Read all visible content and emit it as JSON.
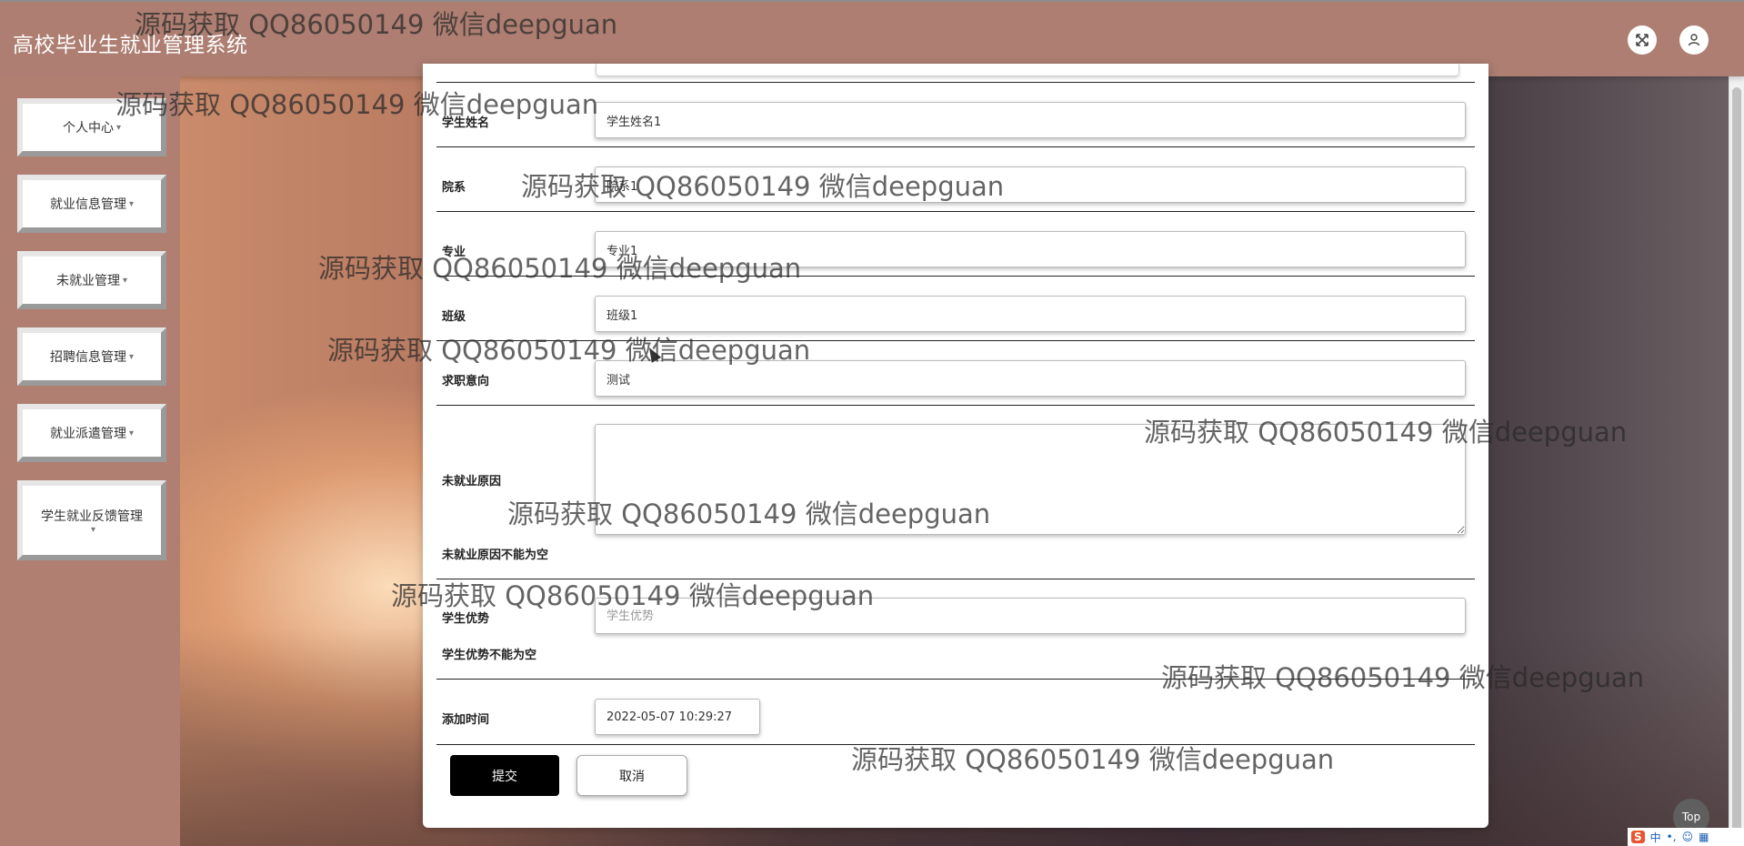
{
  "header": {
    "title": "高校毕业生就业管理系统"
  },
  "sidebar": {
    "items": [
      {
        "label": "个人中心"
      },
      {
        "label": "就业信息管理"
      },
      {
        "label": "未就业管理"
      },
      {
        "label": "招聘信息管理"
      },
      {
        "label": "就业派遣管理"
      },
      {
        "label": "学生就业反馈管理"
      }
    ]
  },
  "form": {
    "fields": [
      {
        "label": "学生姓名",
        "value": "学生姓名1"
      },
      {
        "label": "院系",
        "value": "院系1"
      },
      {
        "label": "专业",
        "value": "专业1"
      },
      {
        "label": "班级",
        "value": "班级1"
      },
      {
        "label": "求职意向",
        "value": "测试"
      },
      {
        "label": "未就业原因",
        "value": "",
        "error": "未就业原因不能为空"
      },
      {
        "label": "学生优势",
        "value": "",
        "placeholder": "学生优势",
        "error": "学生优势不能为空"
      },
      {
        "label": "添加时间",
        "value": "2022-05-07 10:29:27"
      }
    ],
    "submit_label": "提交",
    "cancel_label": "取消"
  },
  "top_button_label": "Top",
  "ime": {
    "logo": "S",
    "lang": "中"
  },
  "watermark": {
    "text": "源码获取 QQ86050149 微信deepguan"
  }
}
